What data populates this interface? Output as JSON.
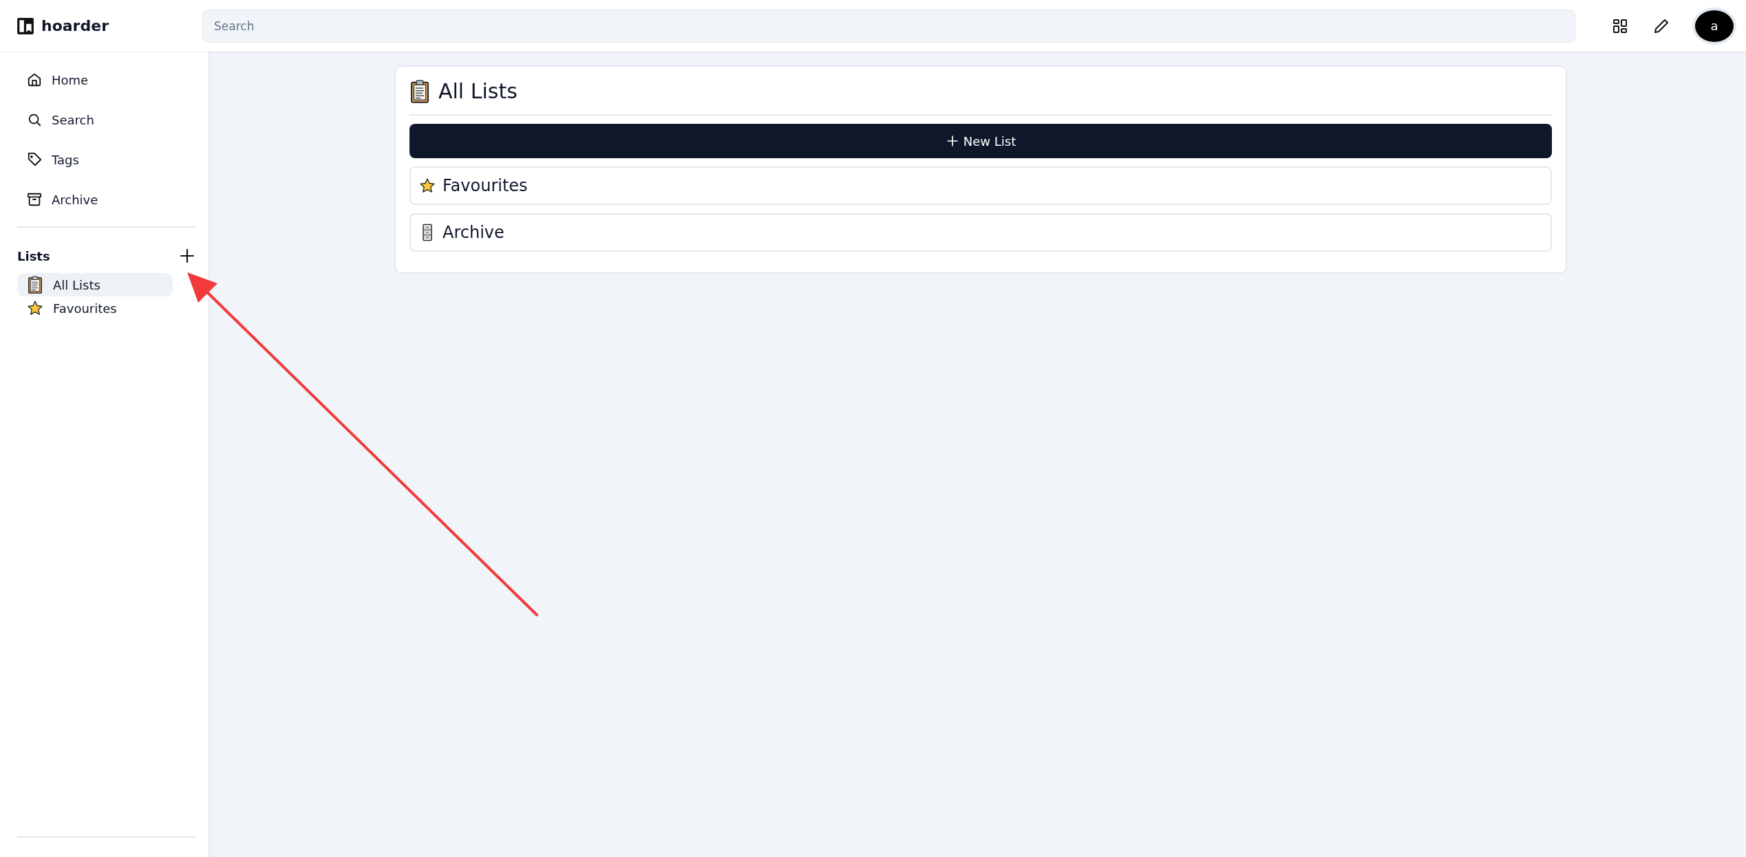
{
  "app": {
    "name": "hoarder"
  },
  "search": {
    "placeholder": "Search"
  },
  "user": {
    "initial": "a"
  },
  "sidebar": {
    "items": [
      {
        "label": "Home",
        "kind": "home"
      },
      {
        "label": "Search",
        "kind": "search"
      },
      {
        "label": "Tags",
        "kind": "tags"
      },
      {
        "label": "Archive",
        "kind": "archive"
      }
    ],
    "lists_heading": "Lists",
    "lists": [
      {
        "label": "All Lists",
        "kind": "clipboard",
        "selected": true
      },
      {
        "label": "Favourites",
        "kind": "star",
        "selected": false
      }
    ]
  },
  "main": {
    "title": "All Lists",
    "new_button": "New List",
    "lists": [
      {
        "label": "Favourites",
        "kind": "star"
      },
      {
        "label": "Archive",
        "kind": "cabinet"
      }
    ]
  }
}
